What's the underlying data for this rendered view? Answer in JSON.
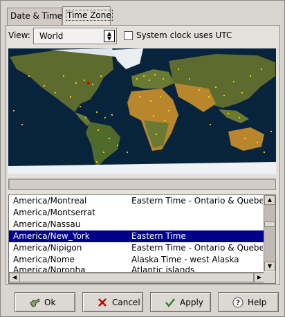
{
  "tabs": [
    {
      "label": "Date & Time",
      "active": false
    },
    {
      "label": "Time Zone",
      "active": true
    }
  ],
  "view": {
    "label": "View:",
    "selected": "World"
  },
  "utc_checkbox": {
    "label": "System clock uses UTC",
    "checked": false
  },
  "map": {
    "ocean_color": "#07243c",
    "land_color": "#5d6b2e",
    "desert_color": "#b8862c",
    "ice_color": "#eef2f6",
    "city_dot_color": "#ffd800",
    "selected_city_color": "#e00000"
  },
  "status_text": "",
  "timezones": [
    {
      "zone": "America/Montreal",
      "description": "Eastern Time - Ontario & Quebec"
    },
    {
      "zone": "America/Montserrat",
      "description": ""
    },
    {
      "zone": "America/Nassau",
      "description": ""
    },
    {
      "zone": "America/New_York",
      "description": "Eastern Time",
      "selected": true
    },
    {
      "zone": "America/Nipigon",
      "description": "Eastern Time - Ontario & Quebec"
    },
    {
      "zone": "America/Nome",
      "description": "Alaska Time - west Alaska"
    },
    {
      "zone": "America/Noronha",
      "description": "Atlantic islands"
    }
  ],
  "buttons": [
    {
      "label": "Ok",
      "icon": "ok-hand-icon"
    },
    {
      "label": "Cancel",
      "icon": "cancel-x-icon"
    },
    {
      "label": "Apply",
      "icon": "checkmark-icon"
    },
    {
      "label": "Help",
      "icon": "help-question-icon"
    }
  ],
  "selection_color": "#00008b"
}
